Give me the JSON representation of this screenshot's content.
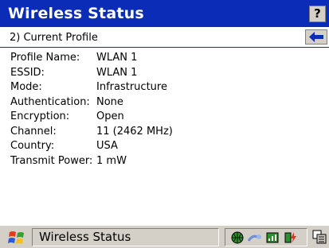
{
  "window": {
    "title": "Wireless Status",
    "help_label": "?"
  },
  "subheader": {
    "label": "2) Current Profile",
    "back_icon": "left-arrow-icon"
  },
  "fields": [
    {
      "label": "Profile Name:",
      "value": "WLAN 1"
    },
    {
      "label": "ESSID:",
      "value": "WLAN 1"
    },
    {
      "label": "Mode:",
      "value": "Infrastructure"
    },
    {
      "label": "Authentication:",
      "value": "None"
    },
    {
      "label": "Encryption:",
      "value": "Open"
    },
    {
      "label": "Channel:",
      "value": "11 (2462 MHz)"
    },
    {
      "label": "Country:",
      "value": "USA"
    },
    {
      "label": "Transmit Power:",
      "value": "1 mW"
    }
  ],
  "taskbar": {
    "start_icon": "windows-flag-icon",
    "active_task": "Wireless Status",
    "tray_icons": [
      "network-globe-icon",
      "connection-icon",
      "wireless-signal-icon",
      "battery-icon"
    ],
    "keyboard_icon": "input-panel-icon"
  },
  "colors": {
    "title_bar": "#0a2cb6",
    "chrome": "#d4d0c8"
  }
}
